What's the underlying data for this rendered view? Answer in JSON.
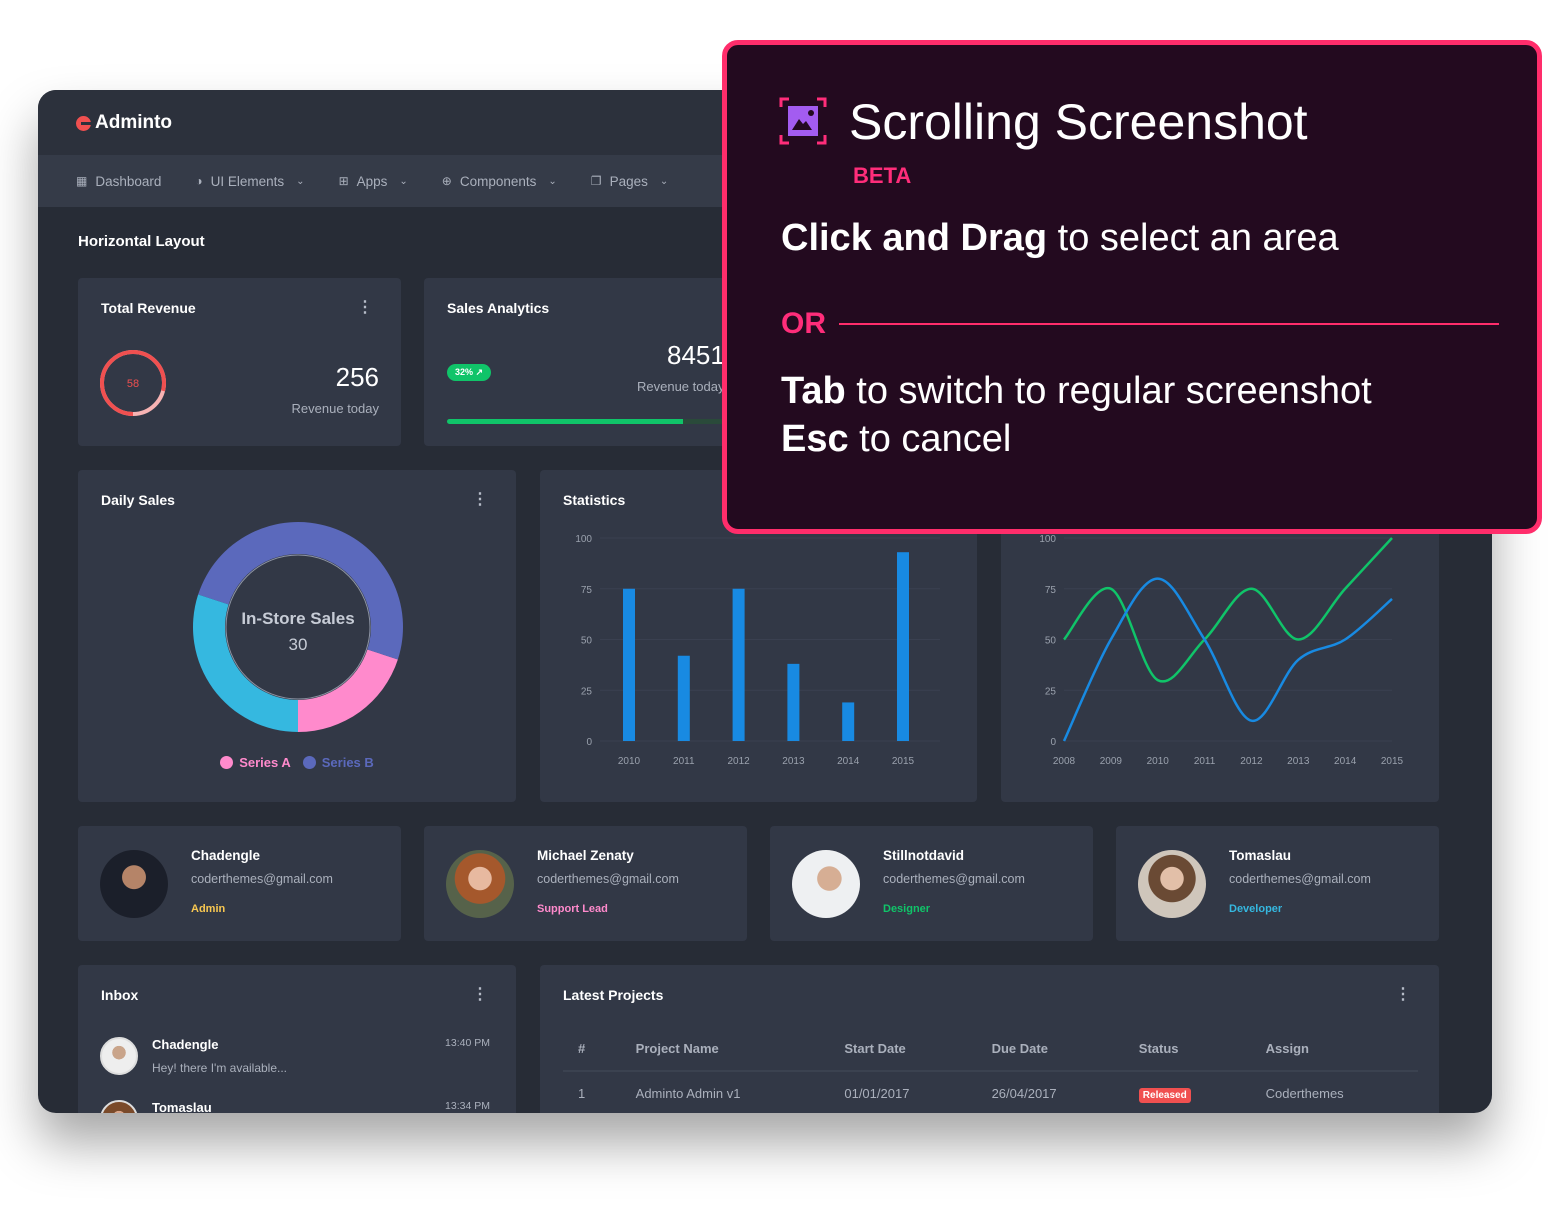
{
  "app": {
    "name": "Adminto"
  },
  "nav": [
    {
      "label": "Dashboard",
      "icon": "dashboard-icon",
      "dropdown": false
    },
    {
      "label": "UI Elements",
      "icon": "drop-icon",
      "dropdown": true
    },
    {
      "label": "Apps",
      "icon": "grid-icon",
      "dropdown": true
    },
    {
      "label": "Components",
      "icon": "globe-icon",
      "dropdown": true
    },
    {
      "label": "Pages",
      "icon": "page-icon",
      "dropdown": true
    }
  ],
  "page_title": "Horizontal Layout",
  "total_revenue": {
    "title": "Total Revenue",
    "ring_value": "58",
    "ring_percent": 58,
    "value": "256",
    "caption": "Revenue today",
    "color": "#f05050"
  },
  "sales_analytics": {
    "title": "Sales Analytics",
    "badge": "32% ↗",
    "value": "8451",
    "caption": "Revenue today",
    "progress": 0.62
  },
  "daily_sales": {
    "title": "Daily Sales",
    "center_label": "In-Store Sales",
    "center_value": "30",
    "legend": [
      {
        "name": "Series A",
        "color": "#ff8acc"
      },
      {
        "name": "Series B",
        "color": "#5b69bc"
      }
    ]
  },
  "chart_data": [
    {
      "type": "bar",
      "title": "Statistics",
      "categories": [
        "2010",
        "2011",
        "2012",
        "2013",
        "2014",
        "2015"
      ],
      "values": [
        75,
        42,
        75,
        38,
        19,
        93
      ],
      "ylim": [
        0,
        100
      ],
      "yticks": [
        0,
        25,
        50,
        75,
        100
      ],
      "grid": true,
      "color": "#188ae2"
    },
    {
      "type": "line",
      "x": [
        "2008",
        "2009",
        "2010",
        "2011",
        "2012",
        "2013",
        "2014",
        "2015"
      ],
      "ylim": [
        0,
        100
      ],
      "yticks": [
        0,
        25,
        50,
        75,
        100
      ],
      "grid": true,
      "series": [
        {
          "values": [
            50,
            75,
            30,
            50,
            75,
            50,
            75,
            100
          ],
          "color": "#10c469"
        },
        {
          "values": [
            0,
            50,
            80,
            50,
            10,
            40,
            50,
            70
          ],
          "color": "#188ae2"
        }
      ]
    },
    {
      "type": "pie",
      "title": "Daily Sales",
      "values": [
        {
          "label": "cyan",
          "value": 30,
          "color": "#35b8e0"
        },
        {
          "label": "purple",
          "value": 50,
          "color": "#5b69bc"
        },
        {
          "label": "pink",
          "value": 20,
          "color": "#ff8acc"
        }
      ]
    }
  ],
  "users": [
    {
      "name": "Chadengle",
      "email": "coderthemes@gmail.com",
      "role": "Admin",
      "role_color": "#f9c851"
    },
    {
      "name": "Michael Zenaty",
      "email": "coderthemes@gmail.com",
      "role": "Support Lead",
      "role_color": "#ff8acc"
    },
    {
      "name": "Stillnotdavid",
      "email": "coderthemes@gmail.com",
      "role": "Designer",
      "role_color": "#10c469"
    },
    {
      "name": "Tomaslau",
      "email": "coderthemes@gmail.com",
      "role": "Developer",
      "role_color": "#35b8e0"
    }
  ],
  "inbox": {
    "title": "Inbox",
    "messages": [
      {
        "name": "Chadengle",
        "message": "Hey! there I'm available...",
        "time": "13:40 PM"
      },
      {
        "name": "Tomaslau",
        "message": "",
        "time": "13:34 PM"
      }
    ]
  },
  "projects": {
    "title": "Latest Projects",
    "columns": [
      "#",
      "Project Name",
      "Start Date",
      "Due Date",
      "Status",
      "Assign"
    ],
    "rows": [
      {
        "id": "1",
        "name": "Adminto Admin v1",
        "start": "01/01/2017",
        "due": "26/04/2017",
        "status": "Released",
        "assign": "Coderthemes"
      }
    ]
  },
  "overlay": {
    "title": "Scrolling Screenshot",
    "badge": "BETA",
    "line1_bold": "Click and Drag",
    "line1_rest": " to select an area",
    "or": "OR",
    "line2_bold": "Tab",
    "line2_rest": " to switch to regular screenshot",
    "line3_bold": "Esc",
    "line3_rest": " to cancel",
    "accent": "#ff2d6b"
  }
}
